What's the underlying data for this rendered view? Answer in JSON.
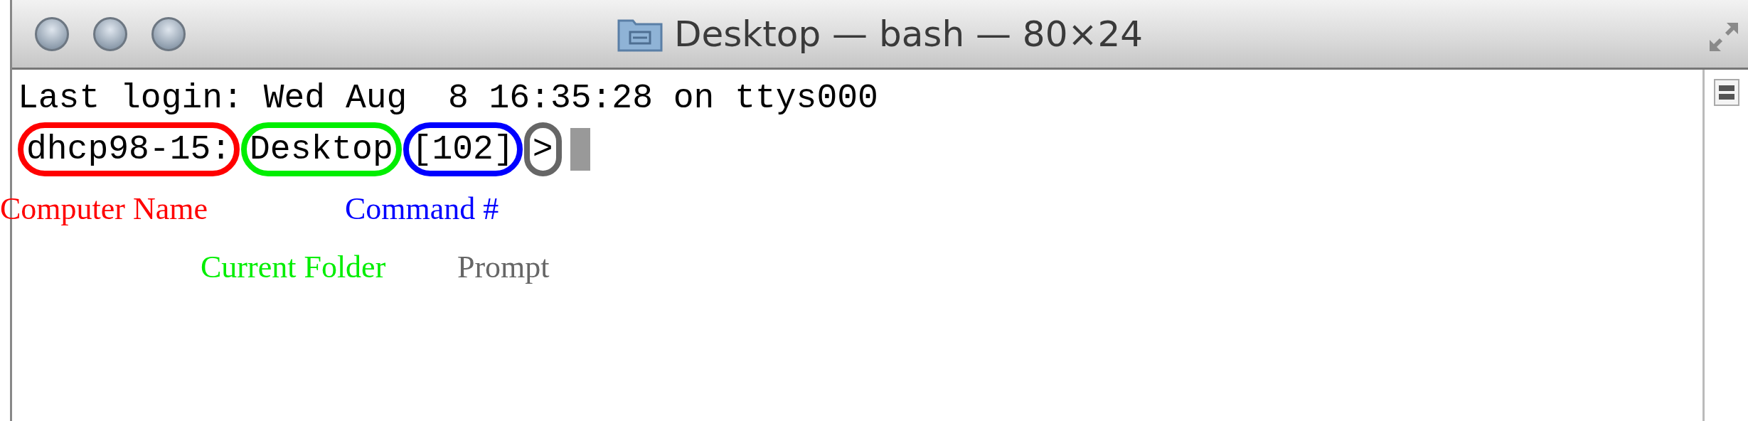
{
  "window": {
    "title": "Desktop — bash — 80×24"
  },
  "terminal": {
    "lines": [
      "Last login: Wed Aug  8 16:35:28 on ttys000"
    ],
    "prompt_segments": [
      {
        "text": "dhcp98-15:",
        "color": "#ff0000"
      },
      {
        "text": "Desktop",
        "color": "#00ee00"
      },
      {
        "text": "[102]",
        "color": "#0000ff"
      },
      {
        "text": ">",
        "color": "#666666"
      }
    ]
  },
  "annotations": [
    {
      "text": "Computer Name",
      "color": "#ff0000"
    },
    {
      "text": "Command #",
      "color": "#0000ff"
    },
    {
      "text": "Current Folder",
      "color": "#00ee00"
    },
    {
      "text": "Prompt",
      "color": "#666666"
    }
  ]
}
